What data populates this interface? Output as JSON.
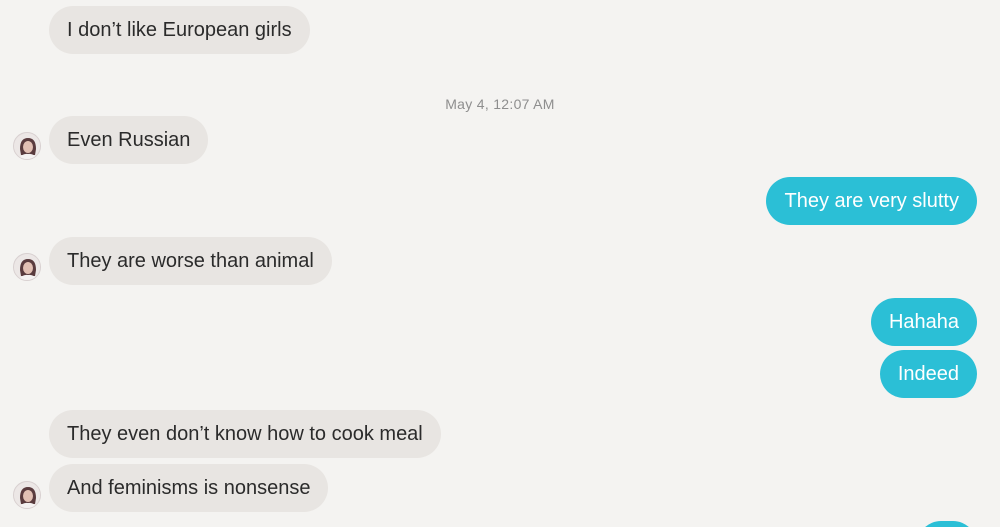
{
  "conversation": {
    "timestamp": "May 4, 12:07 AM",
    "messages": [
      {
        "sender": "them",
        "text": "I don’t like European girls"
      },
      {
        "sender": "them",
        "text": "Even Russian"
      },
      {
        "sender": "me",
        "text": "They are very slutty"
      },
      {
        "sender": "them",
        "text": "They are worse than animal"
      },
      {
        "sender": "me",
        "text": "Hahaha"
      },
      {
        "sender": "me",
        "text": "Indeed"
      },
      {
        "sender": "them",
        "text": "They even don’t know how to cook meal"
      },
      {
        "sender": "them",
        "text": "And feminisms is nonsense"
      }
    ]
  },
  "icons": {
    "avatar": "user-avatar-icon"
  },
  "colors": {
    "background": "#f4f3f1",
    "incoming_bubble": "#e8e5e2",
    "outgoing_bubble": "#2bbfd6",
    "timestamp_text": "#8e8e8e"
  }
}
